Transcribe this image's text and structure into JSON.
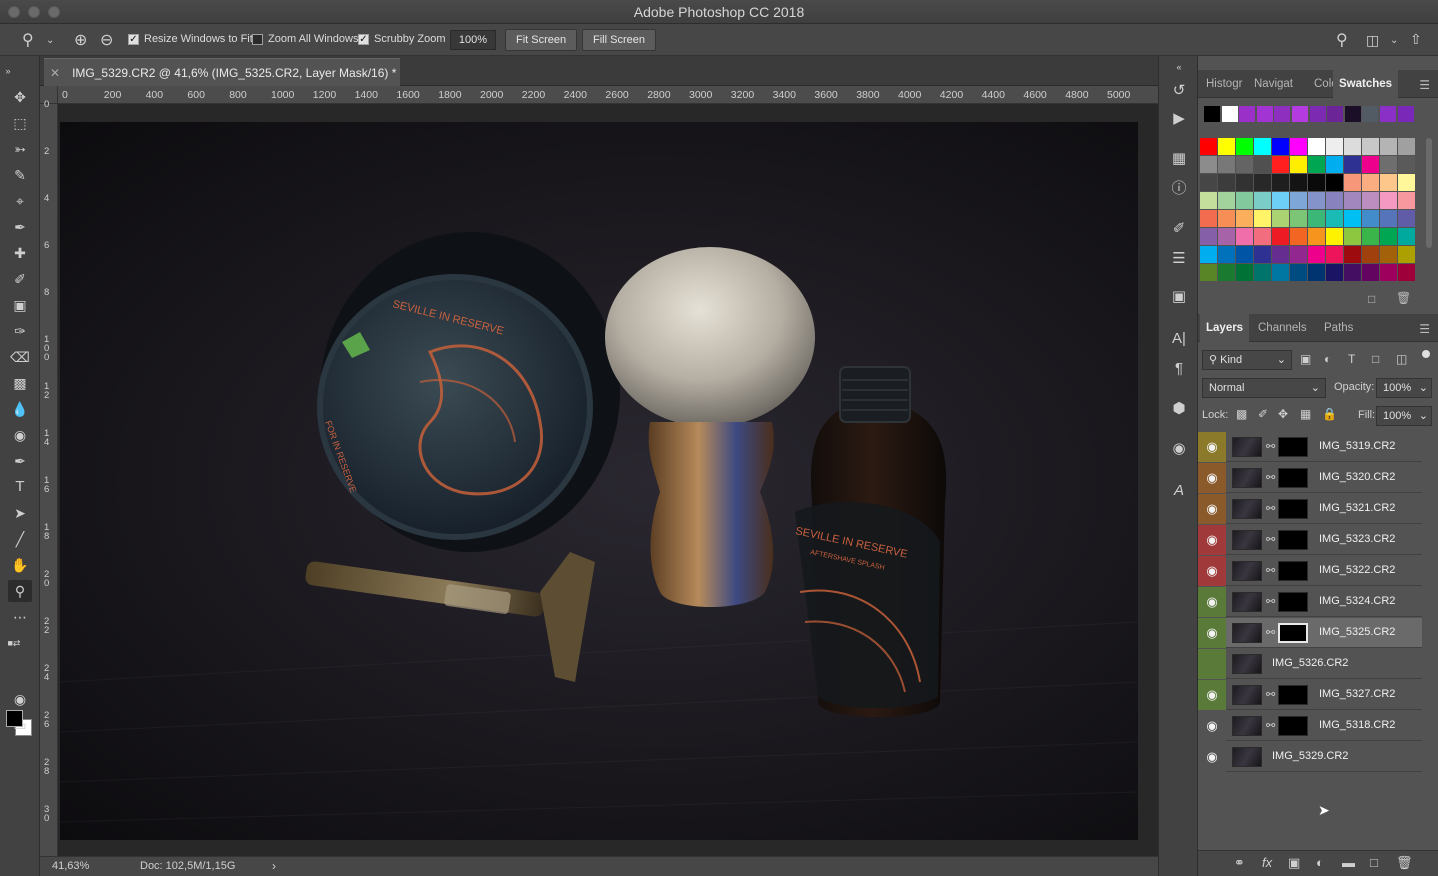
{
  "app": {
    "title": "Adobe Photoshop CC 2018"
  },
  "options": {
    "resize_windows": "Resize Windows to Fit",
    "zoom_all": "Zoom All Windows",
    "scrubby_zoom": "Scrubby Zoom",
    "zoom_value": "100%",
    "fit_screen": "Fit Screen",
    "fill_screen": "Fill Screen",
    "resize_checked": true,
    "zoom_all_checked": false,
    "scrubby_checked": true
  },
  "document": {
    "tab_title": "IMG_5329.CR2 @ 41,6% (IMG_5325.CR2, Layer Mask/16) *",
    "ruler_labels": [
      "0",
      "200",
      "400",
      "600",
      "800",
      "1000",
      "1200",
      "1400",
      "1600",
      "1800",
      "2000",
      "2200",
      "2400",
      "2600",
      "2800",
      "3000",
      "3200",
      "3400",
      "3600",
      "3800",
      "4000",
      "4200",
      "4400",
      "4600",
      "4800",
      "5000"
    ],
    "ruler_v_labels": [
      "0",
      "2",
      "4",
      "6",
      "8",
      "1\n0\n0",
      "1\n2",
      "1\n4",
      "1\n6",
      "1\n8",
      "2\n0",
      "2\n2",
      "2\n4",
      "2\n6",
      "2\n8",
      "3\n0"
    ],
    "zoom": "41,63%",
    "doc_size": "Doc: 102,5M/1,15G",
    "photo_labels": {
      "tin_text": "SEVILLE IN RESERVE",
      "tin_text_2": "FOR IN RESERVE",
      "bottle_text": "SEVILLE IN RESERVE",
      "bottle_sub": "AFTERSHAVE SPLASH"
    }
  },
  "swatches_panel": {
    "tabs": [
      "Histogr",
      "Navigat",
      "Color",
      "Swatches"
    ],
    "active_tab": "Swatches",
    "recent": [
      "#000000",
      "#ffffff",
      "#9b30c8",
      "#a334d4",
      "#8f2fc0",
      "#b33be0",
      "#7d2ab3",
      "#6b2596",
      "#1a0f26",
      "#525a63",
      "#8a30c6",
      "#7a28b8"
    ],
    "grid": [
      [
        "#ff0000",
        "#ffff00",
        "#00ff00",
        "#00ffff",
        "#0000ff",
        "#ff00ff",
        "#ffffff",
        "#eeeeee",
        "#dcdcdc",
        "#c8c8c8",
        "#b4b4b4",
        "#a0a0a0"
      ],
      [
        "#8c8c8c",
        "#787878",
        "#646464",
        "#505050",
        "#ff1f1f",
        "#ffee00",
        "#00a651",
        "#00aeef",
        "#2e3192",
        "#ec008c",
        "#6e6e6e",
        "#5a5a5a"
      ],
      [
        "#464646",
        "#3c3c3c",
        "#323232",
        "#282828",
        "#1e1e1e",
        "#141414",
        "#0a0a0a",
        "#000000",
        "#f7977a",
        "#f9ad81",
        "#fdc68a",
        "#fff79a"
      ],
      [
        "#c4df9b",
        "#a3d39c",
        "#82ca9d",
        "#7bcdc8",
        "#6ecff6",
        "#7ea7d8",
        "#8493ca",
        "#8882be",
        "#a187be",
        "#bc8dbf",
        "#f49ac2",
        "#f6989d"
      ],
      [
        "#f26c4f",
        "#f68e55",
        "#fbaf5c",
        "#fff467",
        "#acd372",
        "#7cc576",
        "#3bb878",
        "#1abbb4",
        "#00bff3",
        "#438ccb",
        "#5574b9",
        "#605ca8"
      ],
      [
        "#855fa8",
        "#a763a8",
        "#f06eaa",
        "#f26d7d",
        "#ed1c24",
        "#f26522",
        "#f7941d",
        "#fff200",
        "#8dc63f",
        "#39b54a",
        "#00a651",
        "#00a99d"
      ],
      [
        "#00aeef",
        "#0072bc",
        "#0054a6",
        "#2e3192",
        "#662d91",
        "#92278f",
        "#ec008c",
        "#ed145b",
        "#9e0b0f",
        "#a0410d",
        "#a36209",
        "#aba000"
      ],
      [
        "#598527",
        "#1a7b30",
        "#007236",
        "#00746b",
        "#0076a3",
        "#004b80",
        "#003471",
        "#1b1464",
        "#440e62",
        "#630460",
        "#9e005d",
        "#9e0039"
      ]
    ]
  },
  "layers_panel": {
    "tabs": [
      "Layers",
      "Channels",
      "Paths"
    ],
    "active_tab": "Layers",
    "filter": "Kind",
    "blend_mode": "Normal",
    "opacity_label": "Opacity:",
    "opacity": "100%",
    "lock_label": "Lock:",
    "fill_label": "Fill:",
    "fill": "100%",
    "layers": [
      {
        "name": "IMG_5319.CR2",
        "color": "#8a7a2a",
        "visible": true,
        "mask": true,
        "selected": false
      },
      {
        "name": "IMG_5320.CR2",
        "color": "#8a5a2a",
        "visible": true,
        "mask": true,
        "selected": false
      },
      {
        "name": "IMG_5321.CR2",
        "color": "#8a5a2a",
        "visible": true,
        "mask": true,
        "selected": false
      },
      {
        "name": "IMG_5323.CR2",
        "color": "#a03a3a",
        "visible": true,
        "mask": true,
        "selected": false
      },
      {
        "name": "IMG_5322.CR2",
        "color": "#a03a3a",
        "visible": true,
        "mask": true,
        "selected": false
      },
      {
        "name": "IMG_5324.CR2",
        "color": "#5a7a3a",
        "visible": true,
        "mask": true,
        "selected": false
      },
      {
        "name": "IMG_5325.CR2",
        "color": "#5a7a3a",
        "visible": true,
        "mask": true,
        "selected": true
      },
      {
        "name": "IMG_5326.CR2",
        "color": "#5a7a3a",
        "visible": false,
        "mask": false,
        "selected": false
      },
      {
        "name": "IMG_5327.CR2",
        "color": "#5a7a3a",
        "visible": true,
        "mask": true,
        "selected": false
      },
      {
        "name": "IMG_5318.CR2",
        "color": "#535353",
        "visible": true,
        "mask": true,
        "selected": false
      },
      {
        "name": "IMG_5329.CR2",
        "color": "#535353",
        "visible": true,
        "mask": false,
        "selected": false
      }
    ]
  }
}
